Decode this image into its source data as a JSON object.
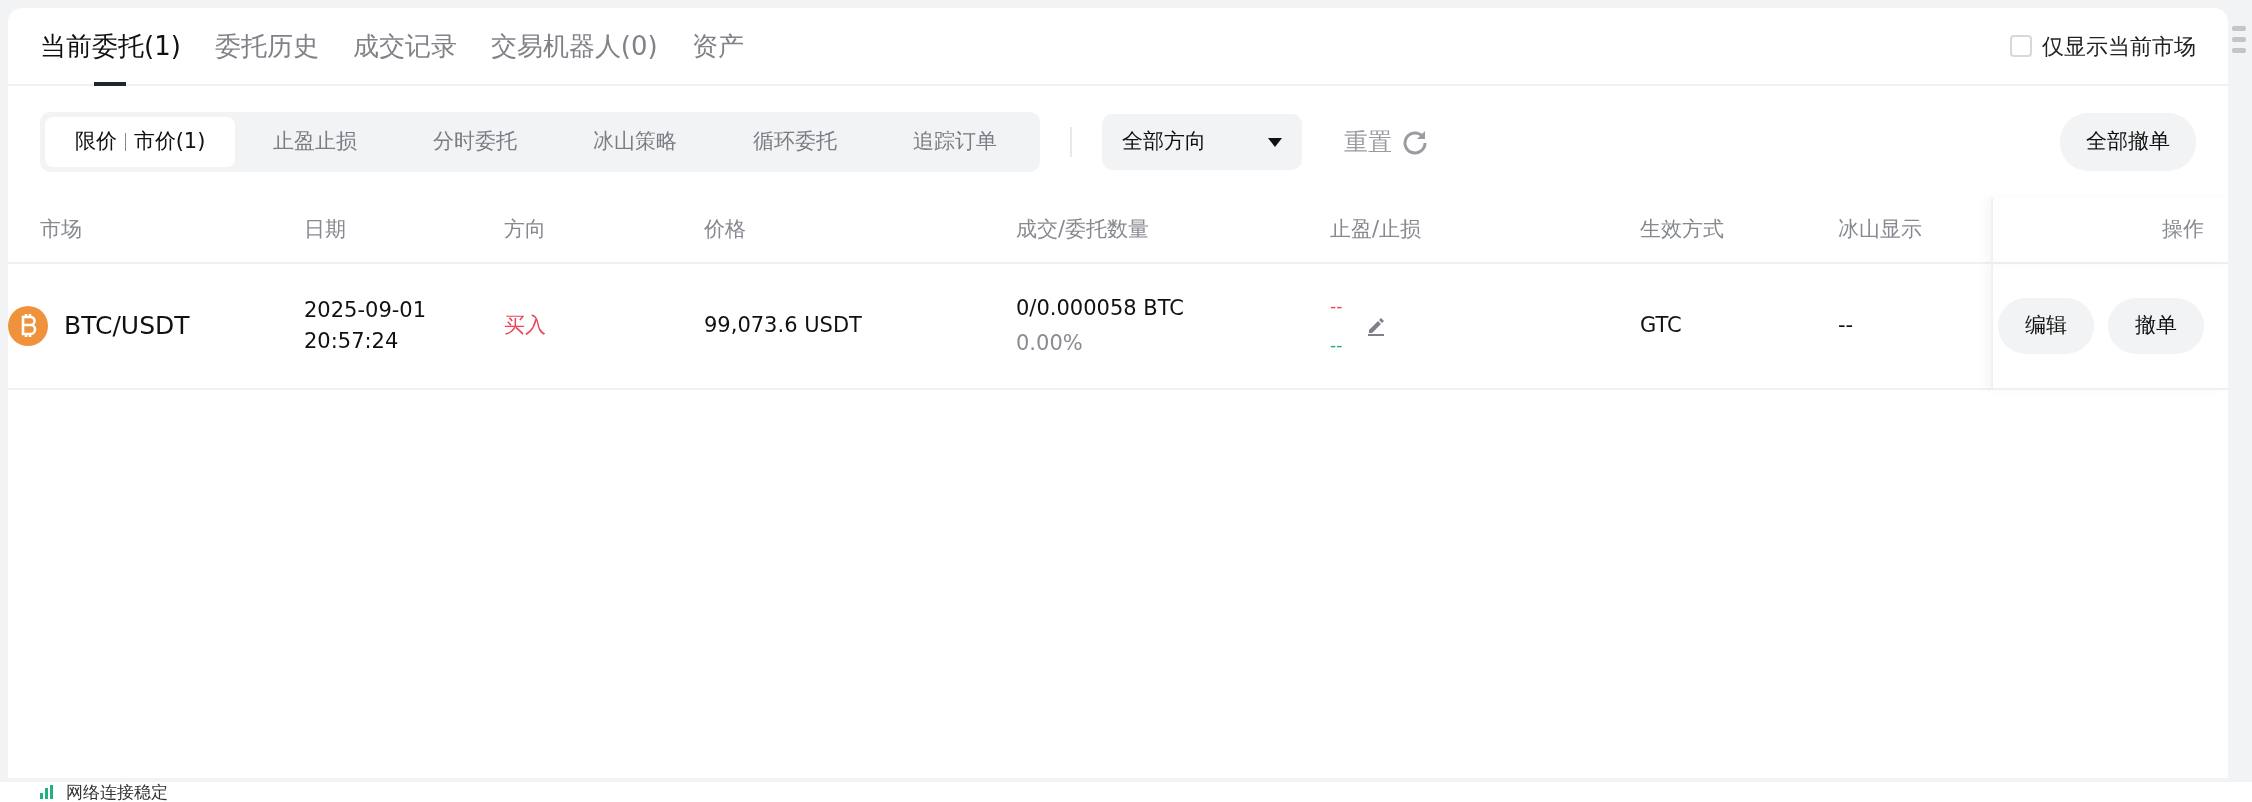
{
  "tabs": [
    {
      "label": "当前委托(1)",
      "selected": true
    },
    {
      "label": "委托历史",
      "selected": false
    },
    {
      "label": "成交记录",
      "selected": false
    },
    {
      "label": "交易机器人(0)",
      "selected": false
    },
    {
      "label": "资产",
      "selected": false
    }
  ],
  "only_current_market": {
    "label": "仅显示当前市场",
    "checked": false
  },
  "order_types": [
    {
      "labels": [
        "限价",
        "市价(1)"
      ],
      "selected": true
    },
    {
      "labels": [
        "止盈止损"
      ],
      "selected": false
    },
    {
      "labels": [
        "分时委托"
      ],
      "selected": false
    },
    {
      "labels": [
        "冰山策略"
      ],
      "selected": false
    },
    {
      "labels": [
        "循环委托"
      ],
      "selected": false
    },
    {
      "labels": [
        "追踪订单"
      ],
      "selected": false
    }
  ],
  "direction_filter": {
    "value": "全部方向"
  },
  "reset": {
    "label": "重置"
  },
  "cancel_all": {
    "label": "全部撤单"
  },
  "table": {
    "columns": [
      "市场",
      "日期",
      "方向",
      "价格",
      "成交/委托数量",
      "止盈/止损",
      "生效方式",
      "冰山显示",
      "操作"
    ],
    "rows": [
      {
        "market": "BTC/USDT",
        "date": "2025-09-01",
        "time": "20:57:24",
        "side": {
          "text": "买入",
          "kind": "buy"
        },
        "price": "99,073.6 USDT",
        "filled": "0/0.000058 BTC",
        "fill_rate": "0.00%",
        "take_profit": "--",
        "stop_loss": "--",
        "time_in_force": "GTC",
        "iceberg": "--",
        "actions": [
          "编辑",
          "撤单"
        ]
      }
    ]
  },
  "status_bar": {
    "text": "网络连接稳定"
  }
}
